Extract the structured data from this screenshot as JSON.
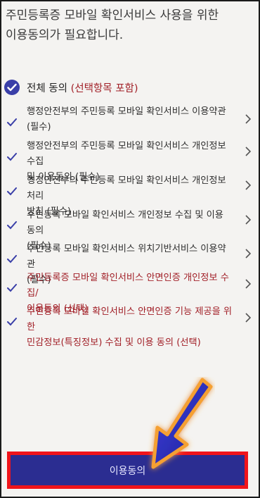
{
  "header": {
    "title_line1": "주민등록증 모바일 확인서비스 사용을 위한",
    "title_line2": "이용동의가 필요합니다."
  },
  "agree_all": {
    "label_main": "전체 동의",
    "label_note": "(선택항목 포함)",
    "icon": "check-circle-icon"
  },
  "terms": [
    {
      "line1": "행정안전부의 주민등록 모바일 확인서비스 이용약관",
      "line2": "(필수)",
      "optional": false
    },
    {
      "line1": "행정안전부의 주민등록 모바일 확인서비스 개인정보 수집",
      "line2": "및 이용동의 (필수)",
      "optional": false
    },
    {
      "line1": "행정안전부의 주민등록 모바일 확인서비스 개인정보처리",
      "line2": "방침 (필수)",
      "optional": false
    },
    {
      "line1": "주민등록 모바일 확인서비스 개인정보 수집 및 이용 동의",
      "line2": "(필수)",
      "optional": false
    },
    {
      "line1": "주민등록 모바일 확인서비스 위치기반서비스 이용약관",
      "line2": "(필수)",
      "optional": false
    },
    {
      "line1": "주민등록증 모바일 확인서비스 안면인증 개인정보 수집/",
      "line2": "이용동의 (선택)",
      "optional": true
    },
    {
      "line1": "주민등록 모바일 확인서비스 안면인증 기능 제공을 위한",
      "line2": "민감정보(특징정보) 수집 및 이용 동의 (선택)",
      "optional": true
    }
  ],
  "cta": {
    "label": "이용동의"
  },
  "colors": {
    "accent": "#2b2d91",
    "optional_text": "#a11f27",
    "highlight_border": "#f0141b"
  }
}
